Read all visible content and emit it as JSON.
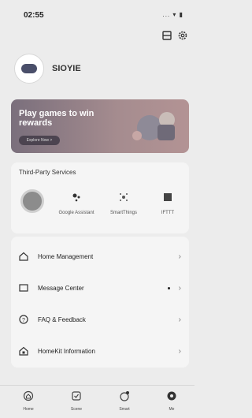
{
  "status_bar": {
    "time": "02:55",
    "indicators": "... ▾ ▮"
  },
  "profile": {
    "name": "SIOYIE"
  },
  "banner": {
    "title": "Play games to win rewards",
    "button": "Explore Now >"
  },
  "services": {
    "title": "Third-Party Services",
    "items": [
      {
        "label": "Google Assistant",
        "icon": "assistant-icon"
      },
      {
        "label": "SmartThings",
        "icon": "smartthings-icon"
      },
      {
        "label": "IFTTT",
        "icon": "ifttt-icon"
      }
    ]
  },
  "menu": {
    "items": [
      {
        "label": "Home Management",
        "icon": "home-icon"
      },
      {
        "label": "Message Center",
        "icon": "message-icon"
      },
      {
        "label": "FAQ & Feedback",
        "icon": "help-icon"
      },
      {
        "label": "HomeKit Information",
        "icon": "homekit-icon"
      }
    ]
  },
  "tabs": [
    {
      "label": "Home",
      "icon": "home-tab-icon"
    },
    {
      "label": "Scene",
      "icon": "scene-tab-icon"
    },
    {
      "label": "Smart",
      "icon": "smart-tab-icon"
    },
    {
      "label": "Me",
      "icon": "me-tab-icon"
    }
  ],
  "colors": {
    "background": "#ececec",
    "card": "#f5f5f5",
    "banner": "#a58c8f"
  }
}
